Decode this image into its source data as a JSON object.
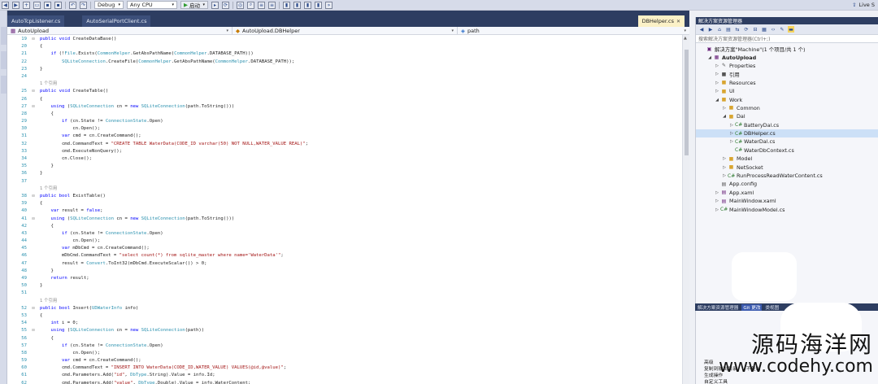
{
  "toolbar": {
    "config": "Debug",
    "platform": "Any CPU",
    "start_label": "启动",
    "live_share": "Live S"
  },
  "tabs": [
    {
      "label": "AutoTcpListener.cs",
      "active": false
    },
    {
      "label": "AutoSerialPortClient.cs",
      "active": false
    }
  ],
  "right_tab": {
    "label": "DBHelper.cs"
  },
  "nav": {
    "project": "AutoUpload",
    "class": "AutoUpload.DBHelper",
    "member": "path"
  },
  "code": [
    {
      "n": "19",
      "fold": "⊟",
      "t": "public void CreateDataBase()"
    },
    {
      "n": "20",
      "fold": "",
      "t": "{"
    },
    {
      "n": "21",
      "fold": "",
      "t": "    if (!File.Exists(CommonHelper.GetAbsPathName(CommonHelper.DATABASE_PATH)))"
    },
    {
      "n": "22",
      "fold": "",
      "t": "        SQLiteConnection.CreateFile(CommonHelper.GetAbsPathName(CommonHelper.DATABASE_PATH));"
    },
    {
      "n": "23",
      "fold": "",
      "t": "}"
    },
    {
      "n": "24",
      "fold": "",
      "t": ""
    },
    {
      "n": "",
      "fold": "",
      "t": "1 个引用",
      "ref": true
    },
    {
      "n": "25",
      "fold": "⊟",
      "t": "public void CreateTable()"
    },
    {
      "n": "26",
      "fold": "",
      "t": "{"
    },
    {
      "n": "27",
      "fold": "⊟",
      "t": "    using (SQLiteConnection cn = new SQLiteConnection(path.ToString()))"
    },
    {
      "n": "28",
      "fold": "",
      "t": "    {"
    },
    {
      "n": "29",
      "fold": "",
      "t": "        if (cn.State != ConnectionState.Open)"
    },
    {
      "n": "30",
      "fold": "",
      "t": "            cn.Open();"
    },
    {
      "n": "31",
      "fold": "",
      "t": "        var cmd = cn.CreateCommand();"
    },
    {
      "n": "32",
      "fold": "",
      "t": "        cmd.CommandText = \"CREATE TABLE WaterData(CODE_ID varchar(50) NOT NULL,WATER_VALUE REAL)\";"
    },
    {
      "n": "33",
      "fold": "",
      "t": "        cmd.ExecuteNonQuery();"
    },
    {
      "n": "34",
      "fold": "",
      "t": "        cn.Close();"
    },
    {
      "n": "35",
      "fold": "",
      "t": "    }"
    },
    {
      "n": "36",
      "fold": "",
      "t": "}"
    },
    {
      "n": "37",
      "fold": "",
      "t": ""
    },
    {
      "n": "",
      "fold": "",
      "t": "1 个引用",
      "ref": true
    },
    {
      "n": "38",
      "fold": "⊟",
      "t": "public bool ExistTable()"
    },
    {
      "n": "39",
      "fold": "",
      "t": "{"
    },
    {
      "n": "40",
      "fold": "",
      "t": "    var result = false;"
    },
    {
      "n": "41",
      "fold": "⊟",
      "t": "    using (SQLiteConnection cn = new SQLiteConnection(path.ToString()))"
    },
    {
      "n": "42",
      "fold": "",
      "t": "    {"
    },
    {
      "n": "43",
      "fold": "",
      "t": "        if (cn.State != ConnectionState.Open)"
    },
    {
      "n": "44",
      "fold": "",
      "t": "            cn.Open();"
    },
    {
      "n": "45",
      "fold": "",
      "t": "        var mDbCmd = cn.CreateCommand();"
    },
    {
      "n": "46",
      "fold": "",
      "t": "        mDbCmd.CommandText = \"select count(*) from sqlite_master where name='WaterData'\";"
    },
    {
      "n": "47",
      "fold": "",
      "t": "        result = Convert.ToInt32(mDbCmd.ExecuteScalar()) > 0;"
    },
    {
      "n": "48",
      "fold": "",
      "t": "    }"
    },
    {
      "n": "49",
      "fold": "",
      "t": "    return result;"
    },
    {
      "n": "50",
      "fold": "",
      "t": "}"
    },
    {
      "n": "51",
      "fold": "",
      "t": ""
    },
    {
      "n": "",
      "fold": "",
      "t": "1 个引用",
      "ref": true
    },
    {
      "n": "52",
      "fold": "⊟",
      "t": "public bool Insert(UDWaterInfo info)"
    },
    {
      "n": "53",
      "fold": "",
      "t": "{"
    },
    {
      "n": "54",
      "fold": "",
      "t": "    int i = 0;"
    },
    {
      "n": "55",
      "fold": "⊟",
      "t": "    using (SQLiteConnection cn = new SQLiteConnection(path))"
    },
    {
      "n": "56",
      "fold": "",
      "t": "    {"
    },
    {
      "n": "57",
      "fold": "",
      "t": "        if (cn.State != ConnectionState.Open)"
    },
    {
      "n": "58",
      "fold": "",
      "t": "            cn.Open();"
    },
    {
      "n": "59",
      "fold": "",
      "t": "        var cmd = cn.CreateCommand();"
    },
    {
      "n": "60",
      "fold": "",
      "t": "        cmd.CommandText = \"INSERT INTO WaterData(CODE_ID,WATER_VALUE) VALUES(@id,@value)\";"
    },
    {
      "n": "61",
      "fold": "",
      "t": "        cmd.Parameters.Add(\"id\", DbType.String).Value = info.Id;"
    },
    {
      "n": "62",
      "fold": "",
      "t": "        cmd.Parameters.Add(\"value\", DbType.Double).Value = info.WaterContent;"
    },
    {
      "n": "63",
      "fold": "",
      "t": "        i = cmd.ExecuteNonQuery();"
    }
  ],
  "solution_explorer": {
    "title": "解决方案资源管理器",
    "search_placeholder": "搜索解决方案资源管理器(Ctrl+;)",
    "nodes": [
      {
        "label": "解决方案\"Machine\"(1 个项目/共 1 个)",
        "indent": 0,
        "exp": "",
        "icon": "solution-icon",
        "glyph": "▣",
        "cls": "c-proj"
      },
      {
        "label": "AutoUpload",
        "indent": 1,
        "exp": "◢",
        "icon": "csharp-project-icon",
        "glyph": "▦",
        "cls": "c-proj",
        "bold": true
      },
      {
        "label": "Properties",
        "indent": 2,
        "exp": "▷",
        "icon": "wrench-icon",
        "glyph": "✎",
        "cls": "c-gray"
      },
      {
        "label": "引用",
        "indent": 2,
        "exp": "▷",
        "icon": "references-icon",
        "glyph": "■",
        "cls": "c-gray"
      },
      {
        "label": "Resources",
        "indent": 2,
        "exp": "▷",
        "icon": "folder-icon",
        "glyph": "■",
        "cls": "c-folder"
      },
      {
        "label": "UI",
        "indent": 2,
        "exp": "▷",
        "icon": "folder-icon",
        "glyph": "■",
        "cls": "c-folder"
      },
      {
        "label": "Work",
        "indent": 2,
        "exp": "◢",
        "icon": "folder-open-icon",
        "glyph": "■",
        "cls": "c-folder"
      },
      {
        "label": "Common",
        "indent": 3,
        "exp": "▷",
        "icon": "folder-icon",
        "glyph": "■",
        "cls": "c-folder"
      },
      {
        "label": "Dal",
        "indent": 3,
        "exp": "◢",
        "icon": "folder-open-icon",
        "glyph": "■",
        "cls": "c-folder"
      },
      {
        "label": "BatteryDal.cs",
        "indent": 4,
        "exp": "▷",
        "icon": "csharp-file-icon",
        "glyph": "C#",
        "cls": "c-cs"
      },
      {
        "label": "DBHelper.cs",
        "indent": 4,
        "exp": "▷",
        "icon": "csharp-file-icon",
        "glyph": "C#",
        "cls": "c-cs",
        "selected": true
      },
      {
        "label": "WaterDal.cs",
        "indent": 4,
        "exp": "▷",
        "icon": "csharp-file-icon",
        "glyph": "C#",
        "cls": "c-cs"
      },
      {
        "label": "WaterDbContext.cs",
        "indent": 4,
        "exp": "",
        "icon": "csharp-file-icon",
        "glyph": "C#",
        "cls": "c-cs"
      },
      {
        "label": "Model",
        "indent": 3,
        "exp": "▷",
        "icon": "folder-icon",
        "glyph": "■",
        "cls": "c-folder"
      },
      {
        "label": "NetSocket",
        "indent": 3,
        "exp": "▷",
        "icon": "folder-icon",
        "glyph": "■",
        "cls": "c-folder"
      },
      {
        "label": "RunProcessReadWaterContent.cs",
        "indent": 3,
        "exp": "▷",
        "icon": "csharp-file-icon",
        "glyph": "C#",
        "cls": "c-cs"
      },
      {
        "label": "App.config",
        "indent": 2,
        "exp": "",
        "icon": "config-file-icon",
        "glyph": "▤",
        "cls": "c-gray"
      },
      {
        "label": "App.xaml",
        "indent": 2,
        "exp": "▷",
        "icon": "xaml-file-icon",
        "glyph": "▤",
        "cls": "c-proj"
      },
      {
        "label": "MainWindow.xaml",
        "indent": 2,
        "exp": "▷",
        "icon": "xaml-file-icon",
        "glyph": "▤",
        "cls": "c-proj"
      },
      {
        "label": "MainWindowModel.cs",
        "indent": 2,
        "exp": "▷",
        "icon": "csharp-file-icon",
        "glyph": "C#",
        "cls": "c-cs"
      }
    ],
    "bottom_tabs": [
      {
        "label": "解决方案资源管理器",
        "active": false
      },
      {
        "label": "Git 更改",
        "active": true
      },
      {
        "label": "类视图",
        "active": false
      }
    ]
  },
  "properties": {
    "rows": [
      "高级",
      "复制到输出目录",
      "生成操作",
      "自定义工具"
    ],
    "value": "不复制"
  },
  "watermark": {
    "cn": "源码海洋网",
    "en": "www.codehy.com"
  }
}
